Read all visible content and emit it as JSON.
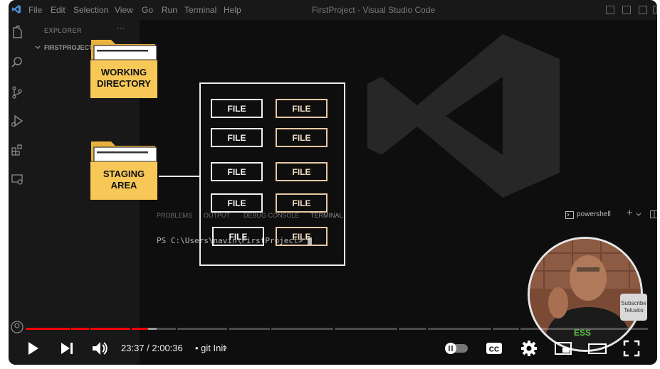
{
  "vscode": {
    "menu": [
      "File",
      "Edit",
      "Selection",
      "View",
      "Go",
      "Run",
      "Terminal",
      "Help"
    ],
    "window_title": "FirstProject - Visual Studio Code",
    "explorer_title": "EXPLORER",
    "explorer_more": "···",
    "project": "FIRSTPROJECT",
    "panel_tabs": [
      "PROBLEMS",
      "OUTPUT",
      "DEBUG CONSOLE",
      "TERMINAL"
    ],
    "shell": "powershell",
    "prompt": "PS C:\\Users\\navin\\FirstProject> "
  },
  "diagram": {
    "working_directory": [
      "WORKING",
      "DIRECTORY"
    ],
    "staging_area": [
      "STAGING",
      "AREA"
    ],
    "file_label": "FILE",
    "folder_color": "#f7c857",
    "gold_border": "#e8c9a4"
  },
  "overlay": {
    "subscribe": [
      "Subscribe",
      "Telusko"
    ]
  },
  "player": {
    "time": "23:37 / 2:00:36",
    "chapter": "• git Init",
    "chapter_arrow": "›",
    "progress_played": 0.197,
    "progress_loaded": 0.21,
    "icons": [
      "play-icon",
      "next-icon",
      "volume-icon",
      "autoplay-toggle",
      "captions-icon",
      "settings-icon",
      "miniplayer-icon",
      "theater-icon",
      "fullscreen-icon"
    ]
  }
}
